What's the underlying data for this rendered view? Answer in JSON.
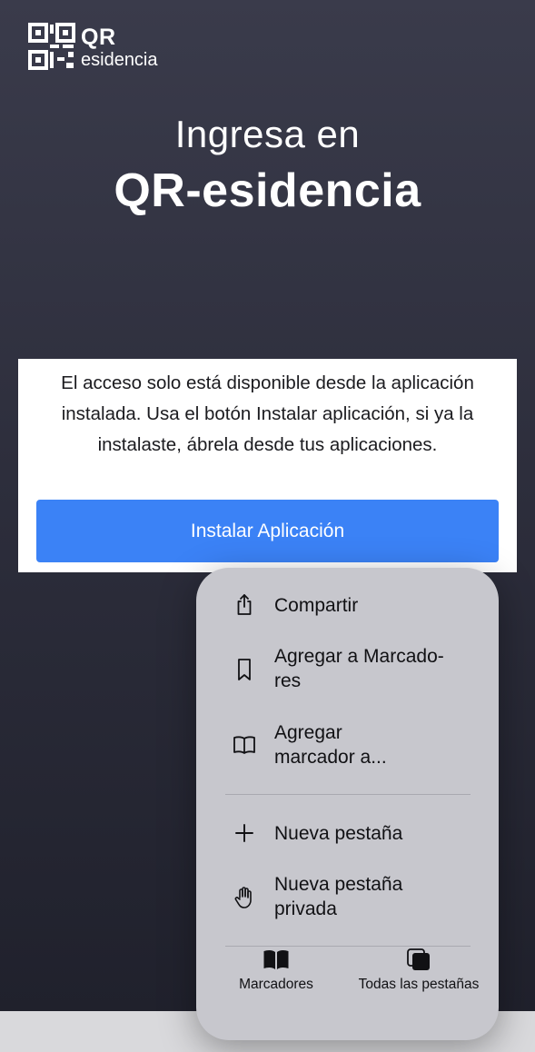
{
  "logo": {
    "line1": "QR",
    "line2": "esidencia"
  },
  "heading": {
    "line1": "Ingresa en",
    "line2": "QR-esidencia"
  },
  "card": {
    "message": "El acceso solo está disponible desde la aplicación instalada. Usa el botón Instalar aplicación, si ya la instalaste, ábrela desde tus aplicaciones.",
    "install_label": "Instalar Aplicación",
    "accent": "#3b82f6"
  },
  "menu": {
    "items": [
      {
        "label": "Compartir",
        "icon": "share-icon"
      },
      {
        "label": "Agregar a Marcado-\nres",
        "icon": "bookmark-icon"
      },
      {
        "label": "Agregar\nmarcador a...",
        "icon": "book-icon"
      },
      {
        "label": "Nueva pestaña",
        "icon": "plus-icon"
      },
      {
        "label": "Nueva pestaña\nprivada",
        "icon": "hand-icon"
      }
    ],
    "tabs": [
      {
        "label": "Marcadores",
        "icon": "bookmarks-book-icon"
      },
      {
        "label": "Todas las pestañas",
        "icon": "tabs-icon"
      }
    ]
  }
}
